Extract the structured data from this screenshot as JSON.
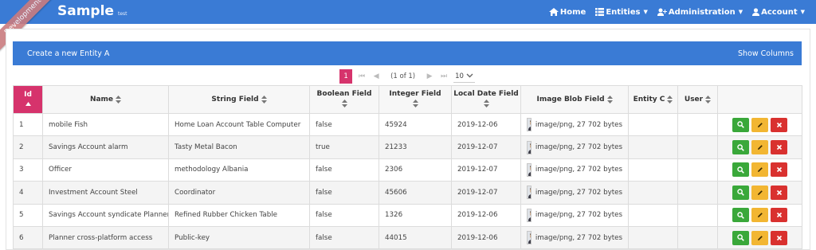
{
  "app": {
    "brand": "Sample",
    "version": "test",
    "ribbon": "Development"
  },
  "nav": {
    "home": "Home",
    "entities": "Entities",
    "administration": "Administration",
    "account": "Account"
  },
  "header": {
    "create_label": "Create a new Entity A",
    "show_columns_label": "Show Columns"
  },
  "paginator": {
    "current_page": "1",
    "report": "(1 of 1)",
    "rows_per_page": "10"
  },
  "table": {
    "columns": {
      "id": "Id",
      "name": "Name",
      "string_field": "String Field",
      "boolean_field": "Boolean Field",
      "integer_field": "Integer Field",
      "local_date_field": "Local Date Field",
      "image_blob_field": "Image Blob Field",
      "entity_c": "Entity C",
      "user": "User"
    },
    "rows": [
      {
        "id": "1",
        "name": "mobile Fish",
        "string_field": "Home Loan Account Table Computer",
        "boolean_field": "false",
        "integer_field": "45924",
        "local_date_field": "2019-12-06",
        "image_blob_field": "image/png, 27 702 bytes",
        "entity_c": "",
        "user": ""
      },
      {
        "id": "2",
        "name": "Savings Account alarm",
        "string_field": "Tasty Metal Bacon",
        "boolean_field": "true",
        "integer_field": "21233",
        "local_date_field": "2019-12-07",
        "image_blob_field": "image/png, 27 702 bytes",
        "entity_c": "",
        "user": ""
      },
      {
        "id": "3",
        "name": "Officer",
        "string_field": "methodology Albania",
        "boolean_field": "false",
        "integer_field": "2306",
        "local_date_field": "2019-12-07",
        "image_blob_field": "image/png, 27 702 bytes",
        "entity_c": "",
        "user": ""
      },
      {
        "id": "4",
        "name": "Investment Account Steel",
        "string_field": "Coordinator",
        "boolean_field": "false",
        "integer_field": "45606",
        "local_date_field": "2019-12-07",
        "image_blob_field": "image/png, 27 702 bytes",
        "entity_c": "",
        "user": ""
      },
      {
        "id": "5",
        "name": "Savings Account syndicate Planner",
        "string_field": "Refined Rubber Chicken Table",
        "boolean_field": "false",
        "integer_field": "1326",
        "local_date_field": "2019-12-06",
        "image_blob_field": "image/png, 27 702 bytes",
        "entity_c": "",
        "user": ""
      },
      {
        "id": "6",
        "name": "Planner cross-platform access",
        "string_field": "Public-key",
        "boolean_field": "false",
        "integer_field": "44015",
        "local_date_field": "2019-12-06",
        "image_blob_field": "image/png, 27 702 bytes",
        "entity_c": "",
        "user": ""
      }
    ]
  },
  "colors": {
    "primary": "#3a7bd5",
    "accent": "#d6336c",
    "view": "#3aa83a",
    "edit": "#f2b632",
    "delete": "#d9312f",
    "ribbon": "#c97c7f"
  }
}
